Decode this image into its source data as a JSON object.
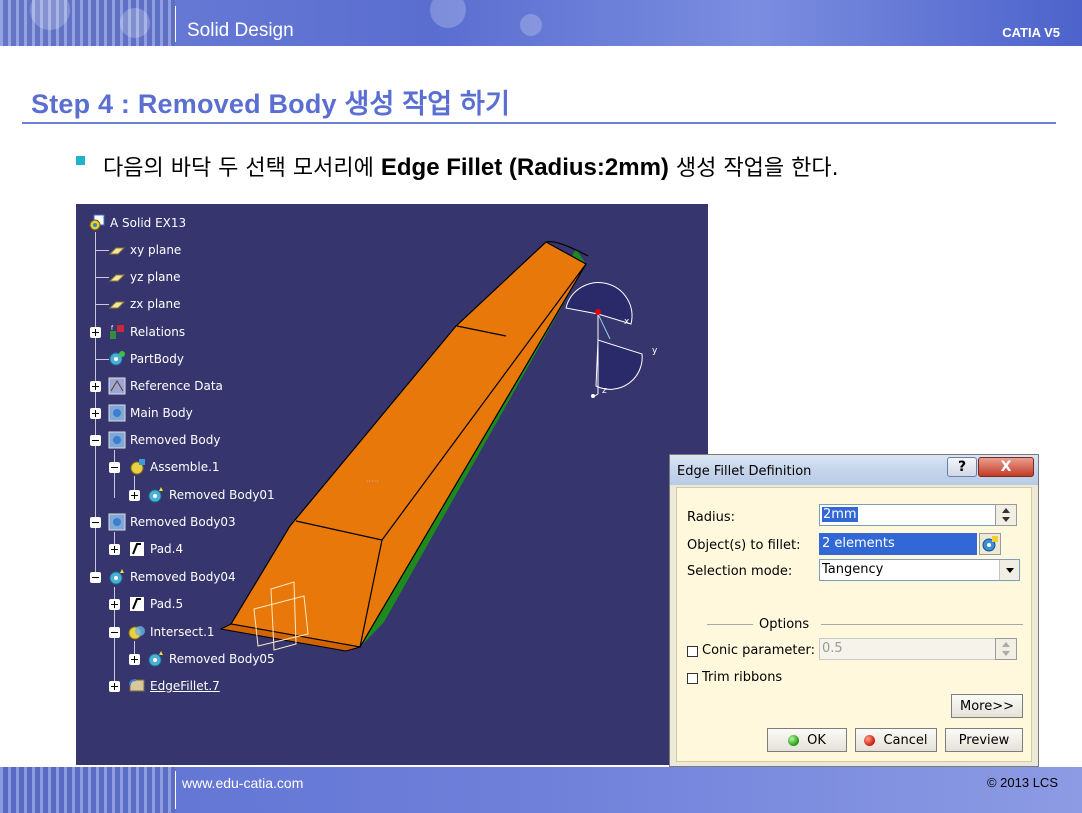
{
  "header": {
    "section": "Solid Design",
    "brand": "CATIA V5"
  },
  "step_title": "Step 4 : Removed Body 생성 작업 하기",
  "instruction": {
    "prefix": "다음의 바닥 두 선택 모서리에 ",
    "bold": "Edge Fillet (Radius:2mm)",
    "suffix": " 생성 작업을 한다."
  },
  "tree": {
    "root": "A Solid EX13",
    "items": [
      {
        "label": "xy plane"
      },
      {
        "label": "yz plane"
      },
      {
        "label": "zx plane"
      },
      {
        "label": "Relations"
      },
      {
        "label": "PartBody"
      },
      {
        "label": "Reference Data"
      },
      {
        "label": "Main Body"
      },
      {
        "label": "Removed Body"
      },
      {
        "label": "Assemble.1"
      },
      {
        "label": "Removed Body01"
      },
      {
        "label": "Removed Body03"
      },
      {
        "label": "Pad.4"
      },
      {
        "label": "Removed Body04"
      },
      {
        "label": "Pad.5"
      },
      {
        "label": "Intersect.1"
      },
      {
        "label": "Removed Body05"
      },
      {
        "label": "EdgeFillet.7"
      }
    ]
  },
  "axis": {
    "x": "x",
    "y": "y",
    "z": "z"
  },
  "dialog": {
    "title": "Edge Fillet Definition",
    "help": "?",
    "close": "X",
    "radius_label": "Radius:",
    "radius_value": "2mm",
    "objects_label": "Object(s) to fillet:",
    "objects_value": "2 elements",
    "selection_label": "Selection mode:",
    "selection_value": "Tangency",
    "options_label": "Options",
    "conic_label": "Conic parameter:",
    "conic_value": "0.5",
    "trim_label": "Trim ribbons",
    "more_button": "More>>",
    "ok_button": "OK",
    "cancel_button": "Cancel",
    "preview_button": "Preview"
  },
  "footer": {
    "site": "www.edu-catia.com",
    "copyright": "© 2013 LCS"
  },
  "colors": {
    "accent": "#5a6fd1",
    "viewport_bg": "#36356e",
    "part_orange": "#e8780a",
    "part_green": "#1f8a1c",
    "selection_blue": "#3168d5"
  }
}
